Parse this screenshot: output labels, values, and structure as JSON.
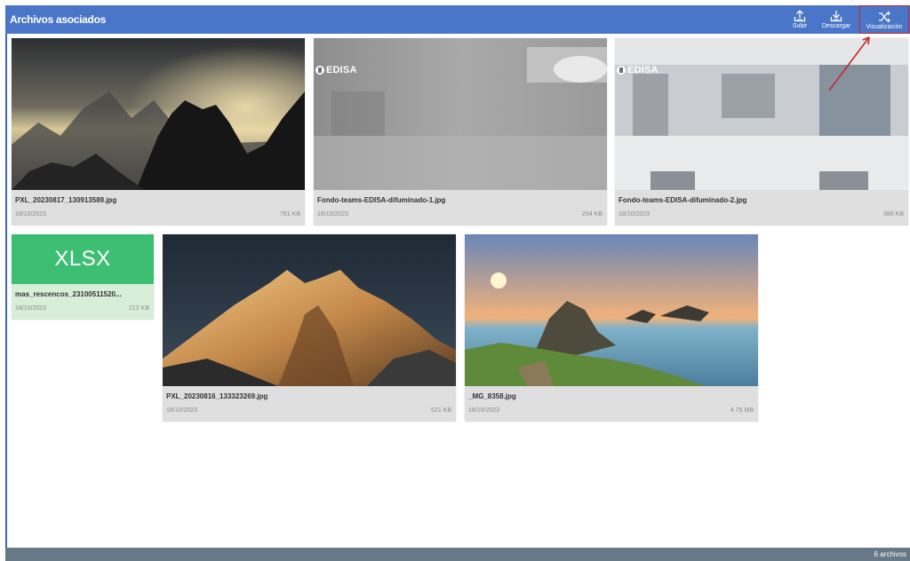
{
  "header": {
    "title": "Archivos asociados",
    "actions": [
      {
        "label": "Subir",
        "icon": "upload-icon"
      },
      {
        "label": "Descargar",
        "icon": "download-icon"
      },
      {
        "label": "Visualización",
        "icon": "shuffle-icon"
      }
    ]
  },
  "files": [
    {
      "name": "PXL_20230817_130913589.jpg",
      "date": "18/10/2023",
      "size": "761 KB"
    },
    {
      "name": "Fondo-teams-EDISA-difuminado-1.jpg",
      "date": "18/10/2023",
      "size": "234 KB",
      "watermark": "EDISA"
    },
    {
      "name": "Fondo-teams-EDISA-difuminado-2.jpg",
      "date": "18/10/2023",
      "size": "386 KB",
      "watermark": "EDISA"
    },
    {
      "name": "mas_rescencos_23100511520...",
      "date": "18/10/2023",
      "size": "212 KB",
      "type_label": "XLSX"
    },
    {
      "name": "PXL_20230816_133323269.jpg",
      "date": "18/10/2023",
      "size": "521 KB"
    },
    {
      "name": "_MG_8358.jpg",
      "date": "18/10/2023",
      "size": "4.75 MB"
    }
  ],
  "status": {
    "count_text": "6 archivos"
  },
  "colors": {
    "header": "#4a76c9",
    "statusbar": "#677886",
    "xlsx": "#3dbf73",
    "highlight": "#c1272d"
  }
}
